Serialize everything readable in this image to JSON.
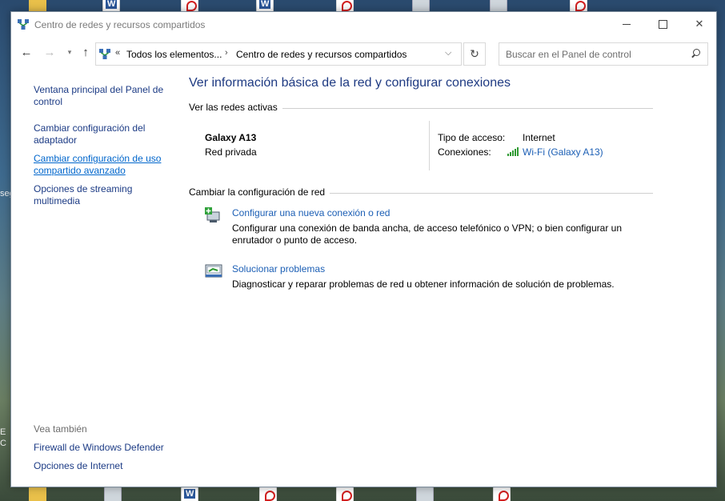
{
  "window": {
    "title": "Centro de redes y recursos compartidos"
  },
  "addressbar": {
    "overflow": "«",
    "crumb1": "Todos los elementos...",
    "separator": "›",
    "crumb2": "Centro de redes y recursos compartidos"
  },
  "search": {
    "placeholder": "Buscar en el Panel de control"
  },
  "leftpane": {
    "links": [
      "Ventana principal del Panel de control",
      "Cambiar configuración del adaptador",
      "Cambiar configuración de uso compartido avanzado",
      "Opciones de streaming multimedia"
    ],
    "see_also_heading": "Vea también",
    "see_also": [
      "Firewall de Windows Defender",
      "Opciones de Internet"
    ]
  },
  "main": {
    "title": "Ver información básica de la red y configurar conexiones",
    "active_networks_label": "Ver las redes activas",
    "network": {
      "name": "Galaxy A13",
      "type": "Red privada",
      "access_label": "Tipo de acceso:",
      "access_value": "Internet",
      "connections_label": "Conexiones:",
      "connection_link": "Wi-Fi (Galaxy A13)"
    },
    "change_label": "Cambiar la configuración de red",
    "tasks": [
      {
        "link": "Configurar una nueva conexión o red",
        "desc": "Configurar una conexión de banda ancha, de acceso telefónico o VPN; o bien configurar un enrutador o punto de acceso.",
        "icon": "new-connection-icon"
      },
      {
        "link": "Solucionar problemas",
        "desc": "Diagnosticar y reparar problemas de red u obtener información de solución de problemas.",
        "icon": "troubleshoot-icon"
      }
    ]
  },
  "desktop": {
    "side_fragments": [
      "seg",
      "E",
      "C"
    ]
  },
  "colors": {
    "link": "#1c5fb5",
    "nav_link": "#1c3b85",
    "title": "#1e3a82",
    "signal": "#2f9a32"
  }
}
